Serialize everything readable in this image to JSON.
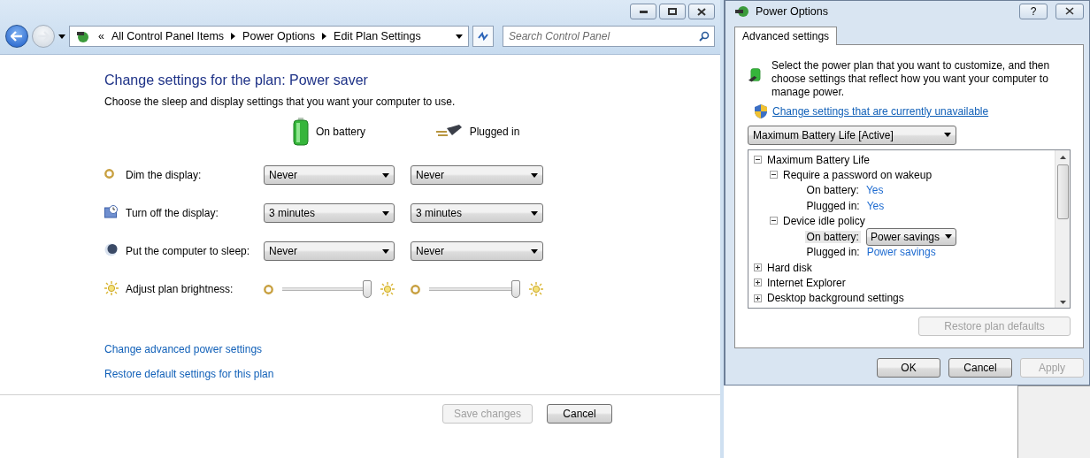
{
  "explorer": {
    "breadcrumb_lead": "«",
    "breadcrumb": [
      "All Control Panel Items",
      "Power Options",
      "Edit Plan Settings"
    ],
    "search": {
      "placeholder": "Search Control Panel"
    }
  },
  "plan": {
    "title": "Change settings for the plan: Power saver",
    "subtitle": "Choose the sleep and display settings that you want your computer to use.",
    "columns": [
      "On battery",
      "Plugged in"
    ],
    "settings": [
      {
        "kind": "dropdown",
        "label": "Dim the display:",
        "values": [
          "Never",
          "Never"
        ]
      },
      {
        "kind": "dropdown",
        "label": "Turn off the display:",
        "values": [
          "3 minutes",
          "3 minutes"
        ]
      },
      {
        "kind": "dropdown",
        "label": "Put the computer to sleep:",
        "values": [
          "Never",
          "Never"
        ]
      },
      {
        "kind": "slider",
        "label": "Adjust plan brightness:",
        "values": [
          {
            "level": 1
          },
          {
            "level": 1
          }
        ]
      }
    ],
    "links": [
      "Change advanced power settings",
      "Restore default settings for this plan"
    ],
    "buttons": [
      {
        "label": "Save changes",
        "disabled": true
      },
      {
        "label": "Cancel",
        "disabled": false
      }
    ]
  },
  "dialog": {
    "title": "Power Options",
    "help": "?",
    "tabs": [
      {
        "label": "Advanced settings",
        "selected": true
      }
    ],
    "intro": "Select the power plan that you want to customize, and then choose settings that reflect how you want your computer to manage power.",
    "admin_link": "Change settings that are currently unavailable",
    "plan_select": "Maximum Battery Life [Active]",
    "tree": [
      {
        "label": "Maximum Battery Life",
        "expanded": true,
        "children": [
          {
            "label": "Require a password on wakeup",
            "expanded": true,
            "children": [
              {
                "kind": "value",
                "label": "On battery:",
                "value": "Yes",
                "selected": false
              },
              {
                "kind": "value",
                "label": "Plugged in:",
                "value": "Yes",
                "selected": false
              }
            ]
          },
          {
            "label": "Device idle policy",
            "expanded": true,
            "children": [
              {
                "kind": "dropdown",
                "label": "On battery:",
                "value": "Power savings",
                "selected": true
              },
              {
                "kind": "value",
                "label": "Plugged in:",
                "value": "Power savings",
                "selected": false
              }
            ]
          }
        ]
      },
      {
        "label": "Hard disk",
        "expanded": false
      },
      {
        "label": "Internet Explorer",
        "expanded": false
      },
      {
        "label": "Desktop background settings",
        "expanded": false
      }
    ],
    "restore": {
      "label": "Restore plan defaults",
      "disabled": true
    },
    "buttons": [
      {
        "label": "OK",
        "disabled": false
      },
      {
        "label": "Cancel",
        "disabled": false
      },
      {
        "label": "Apply",
        "disabled": true
      }
    ]
  }
}
